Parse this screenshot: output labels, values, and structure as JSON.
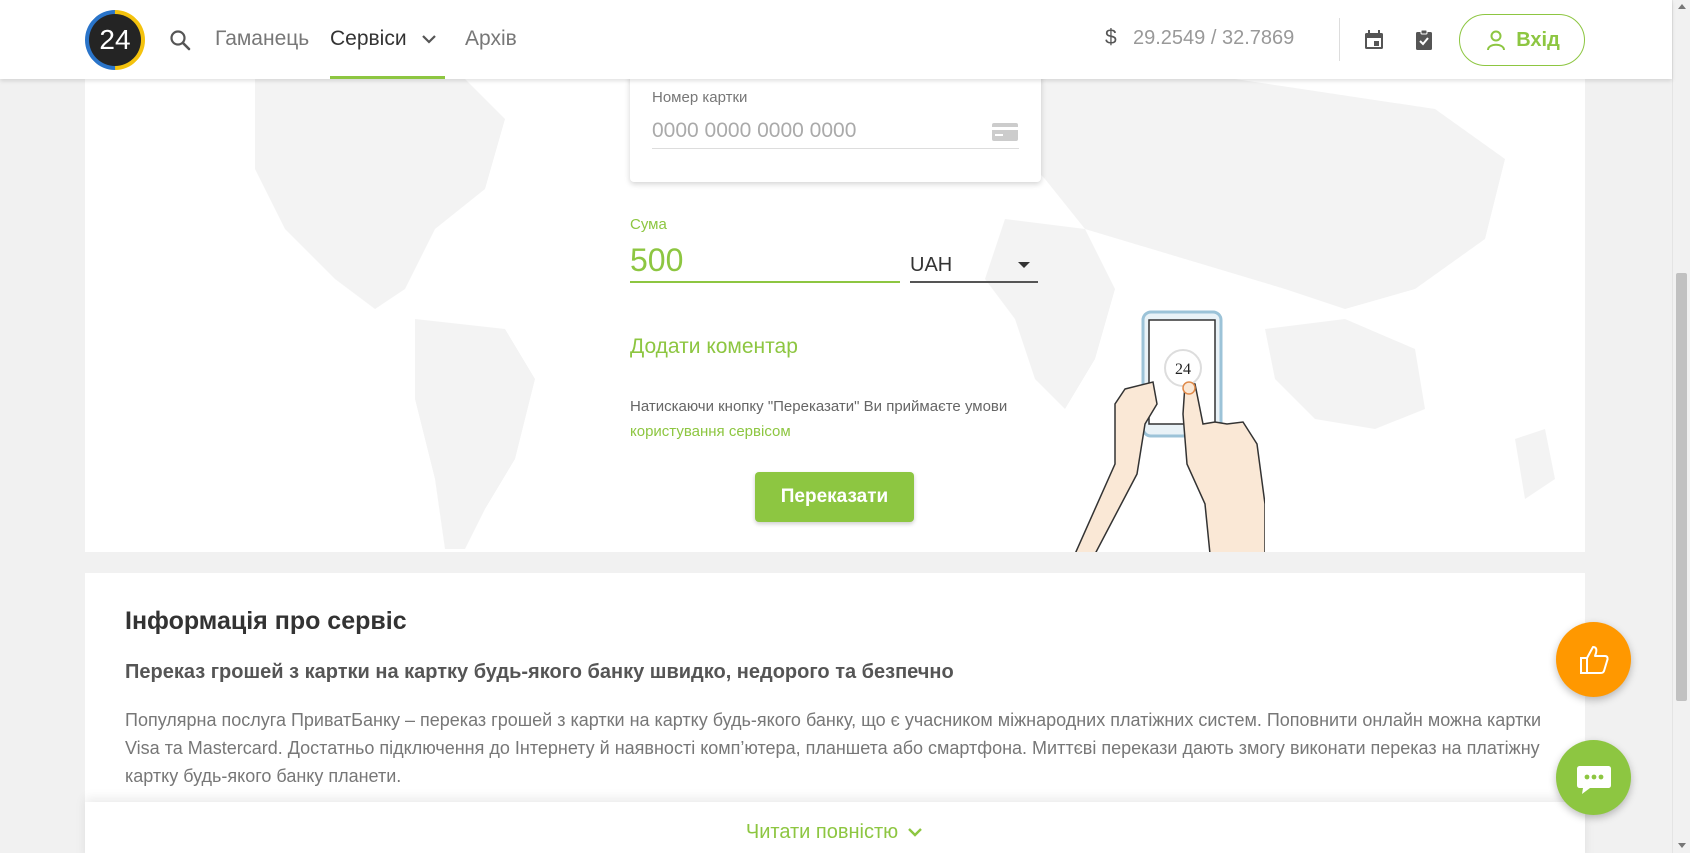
{
  "header": {
    "logo_text": "24",
    "nav": {
      "wallet": "Гаманець",
      "services": "Сервіси",
      "archive": "Архів"
    },
    "currency_symbol": "$",
    "rate": "29.2549 / 32.7869",
    "login_label": "Вхід"
  },
  "form": {
    "card_label": "Номер картки",
    "card_placeholder": "0000 0000 0000 0000",
    "sum_label": "Сума",
    "sum_value": "500",
    "currency": "UAH",
    "add_comment": "Додати коментар",
    "terms_text": "Натискаючи кнопку \"Переказати\" Ви приймаєте умови ",
    "terms_link": "користування сервісом",
    "submit": "Переказати",
    "phone_badge": "24"
  },
  "info": {
    "title": "Інформація про сервіс",
    "subtitle": "Переказ грошей з картки на картку будь-якого банку швидко, недорого та безпечно",
    "text": "Популярна послуга ПриватБанку – переказ грошей з картки на картку будь-якого банку, що є учасником міжнародних платіжних систем. Поповнити онлайн можна картки Visa та Mastercard. Достатньо підключення до Інтернету й наявності комп’ютера, планшета або смартфона. Миттєві перекази дають змогу виконати переказ на платіжну картку будь-якого банку планети.",
    "read_more": "Читати повністю"
  },
  "colors": {
    "accent": "#8dc641",
    "like_fab": "#ff9800"
  }
}
